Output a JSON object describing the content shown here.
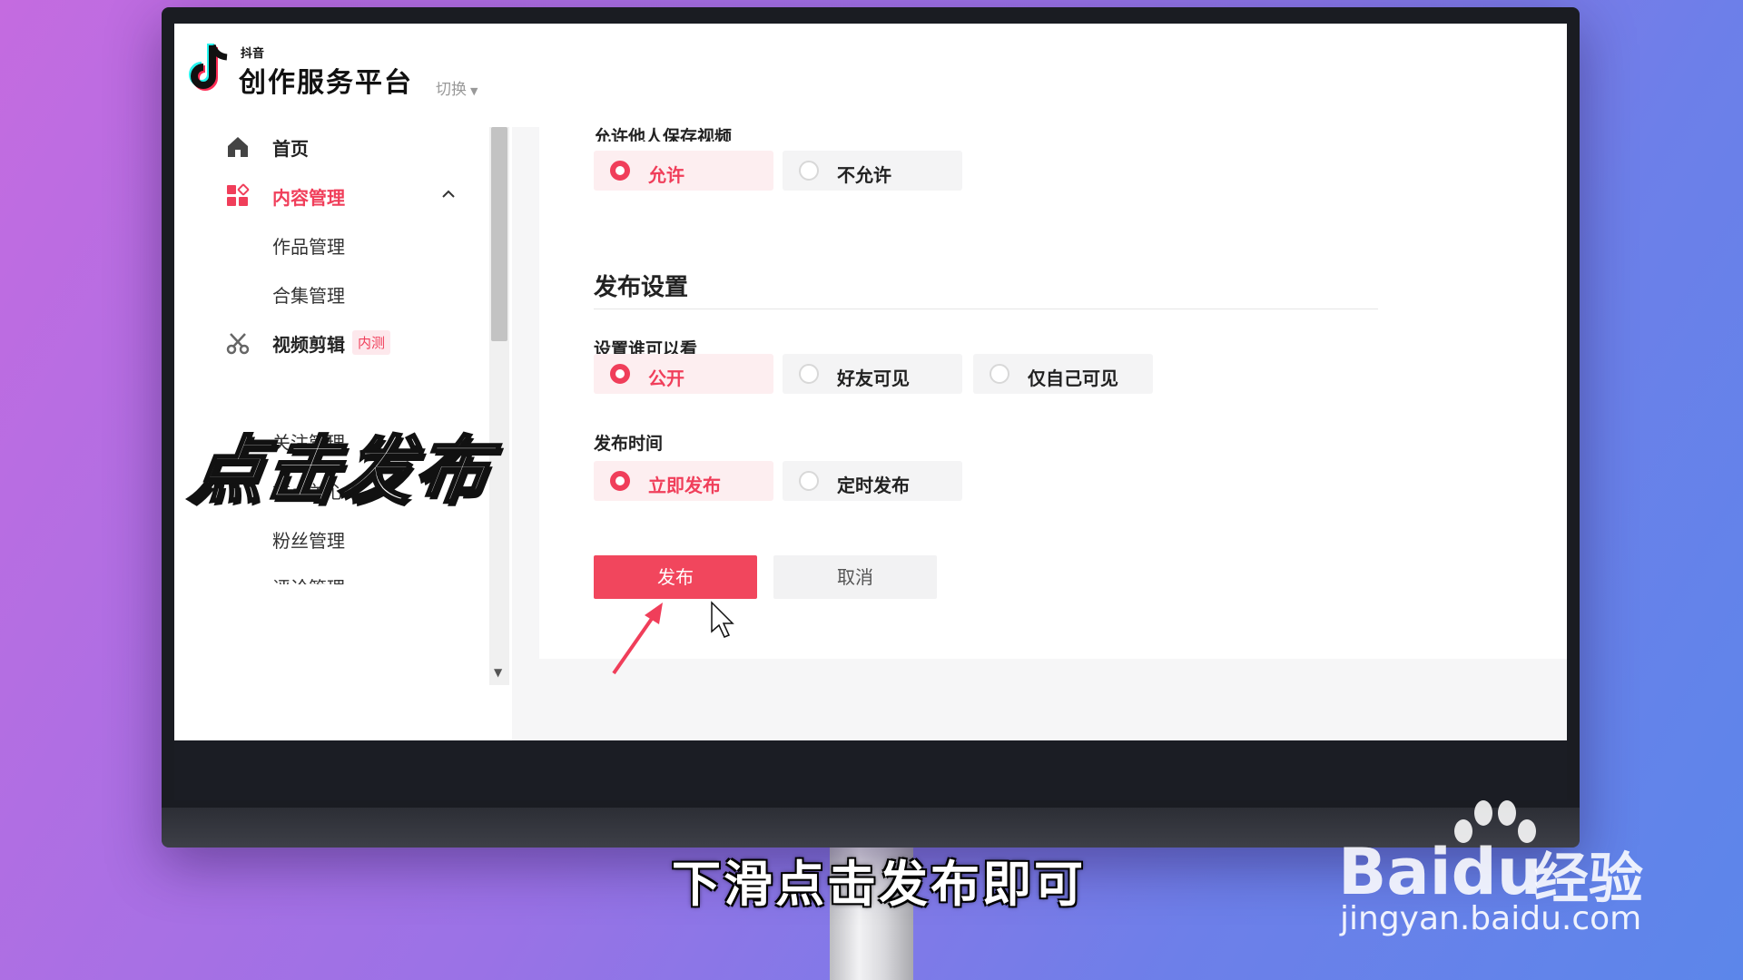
{
  "header": {
    "logo_small": "抖音",
    "logo_title": "创作服务平台",
    "switch_label": "切换"
  },
  "sidebar": {
    "items": [
      {
        "label": "首页"
      },
      {
        "label": "内容管理"
      },
      {
        "label": "作品管理"
      },
      {
        "label": "合集管理"
      },
      {
        "label": "视频剪辑",
        "badge": "内测"
      },
      {
        "label": "关注管理"
      },
      {
        "label": "重点关心"
      },
      {
        "label": "粉丝管理"
      },
      {
        "label": "评论管理"
      }
    ]
  },
  "overlay_caption": "点击发布",
  "form": {
    "save_section": {
      "label": "允许他人保存视频",
      "options": [
        {
          "label": "允许",
          "checked": true
        },
        {
          "label": "不允许",
          "checked": false
        }
      ]
    },
    "publish_title": "发布设置",
    "visibility": {
      "label": "设置谁可以看",
      "options": [
        {
          "label": "公开",
          "checked": true
        },
        {
          "label": "好友可见",
          "checked": false
        },
        {
          "label": "仅自己可见",
          "checked": false
        }
      ]
    },
    "publish_time": {
      "label": "发布时间",
      "options": [
        {
          "label": "立即发布",
          "checked": true
        },
        {
          "label": "定时发布",
          "checked": false
        }
      ]
    },
    "publish_button": "发布",
    "cancel_button": "取消"
  },
  "subtitle": "下滑点击发布即可",
  "watermark": {
    "brand": "Baidu",
    "brand_cn": "经验",
    "url": "jingyan.baidu.com"
  },
  "colors": {
    "accent": "#f03e5a",
    "background": "#f6f6f7"
  }
}
